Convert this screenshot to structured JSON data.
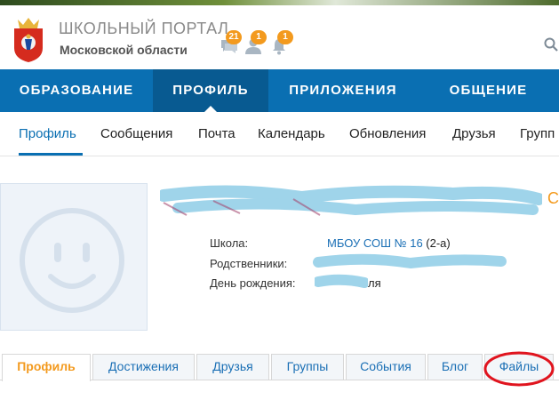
{
  "header": {
    "title": "ШКОЛЬНЫЙ ПОРТАЛ",
    "subtitle": "Московской области",
    "notifications": [
      {
        "icon": "messages-icon",
        "count": "21"
      },
      {
        "icon": "friends-icon",
        "count": "1"
      },
      {
        "icon": "bell-icon",
        "count": "1"
      }
    ]
  },
  "main_nav": [
    "ОБРАЗОВАНИЕ",
    "ПРОФИЛЬ",
    "ПРИЛОЖЕНИЯ",
    "ОБЩЕНИЕ"
  ],
  "main_nav_active": "ПРОФИЛЬ",
  "sub_nav": [
    "Профиль",
    "Сообщения",
    "Почта",
    "Календарь",
    "Обновления",
    "Друзья",
    "Групп"
  ],
  "sub_nav_active": "Профиль",
  "profile": {
    "school_label": "Школа:",
    "school_value": "МБОУ СОШ № 16",
    "school_class": "(2-а)",
    "relatives_label": "Родственники:",
    "birthday_label": "День рождения:",
    "birthday_value": "ля"
  },
  "profile_tabs": [
    "Профиль",
    "Достижения",
    "Друзья",
    "Группы",
    "События",
    "Блог",
    "Файлы"
  ],
  "profile_tab_active": "Профиль",
  "colors": {
    "nav_blue": "#0a6fb2",
    "nav_active": "#085a91",
    "accent_orange": "#f39a1e",
    "link_blue": "#1a6fb5",
    "highlight_red": "#e0141e"
  }
}
